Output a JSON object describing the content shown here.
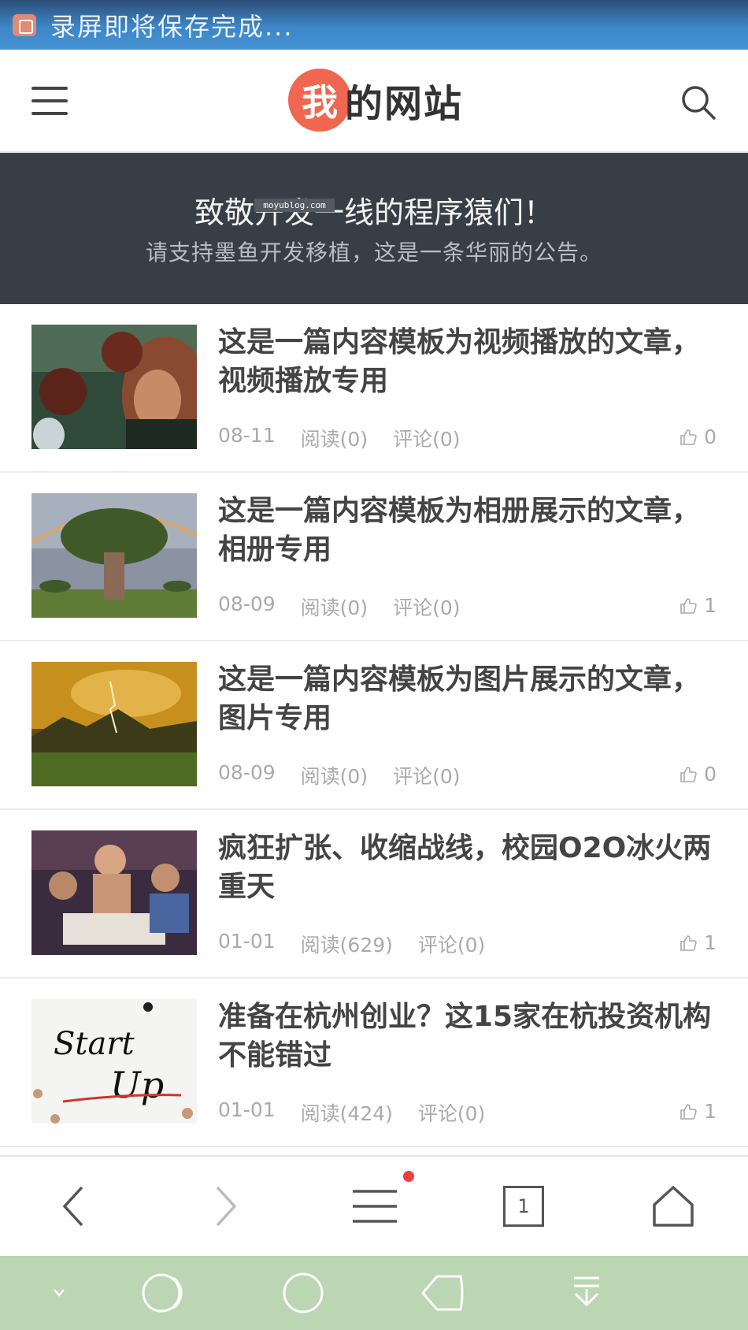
{
  "status_bar": {
    "text": "录屏即将保存完成..."
  },
  "header": {
    "logo_badge": "我",
    "logo_text": "的网站"
  },
  "notice": {
    "title": "致敬开发一线的程序猿们！",
    "subtitle": "请支持墨鱼开发移植，这是一条华丽的公告。",
    "watermark": "moyublog.com"
  },
  "articles": [
    {
      "title": "这是一篇内容模板为视频播放的文章，视频播放专用",
      "date": "08-11",
      "reads": "阅读(0)",
      "comments": "评论(0)",
      "likes": "0"
    },
    {
      "title": "这是一篇内容模板为相册展示的文章，相册专用",
      "date": "08-09",
      "reads": "阅读(0)",
      "comments": "评论(0)",
      "likes": "1"
    },
    {
      "title": "这是一篇内容模板为图片展示的文章，图片专用",
      "date": "08-09",
      "reads": "阅读(0)",
      "comments": "评论(0)",
      "likes": "0"
    },
    {
      "title": "疯狂扩张、收缩战线，校园O2O冰火两重天",
      "date": "01-01",
      "reads": "阅读(629)",
      "comments": "评论(0)",
      "likes": "1"
    },
    {
      "title": "准备在杭州创业？这15家在杭投资机构不能错过",
      "date": "01-01",
      "reads": "阅读(424)",
      "comments": "评论(0)",
      "likes": "1"
    }
  ],
  "thumb_texts": {
    "startup_1": "Start",
    "startup_2": "Up"
  },
  "browser_bar": {
    "tab_count": "1"
  },
  "colors": {
    "brand": "#f06650",
    "notice_bg": "#383e46",
    "nav_bg": "#bcd5b3"
  }
}
